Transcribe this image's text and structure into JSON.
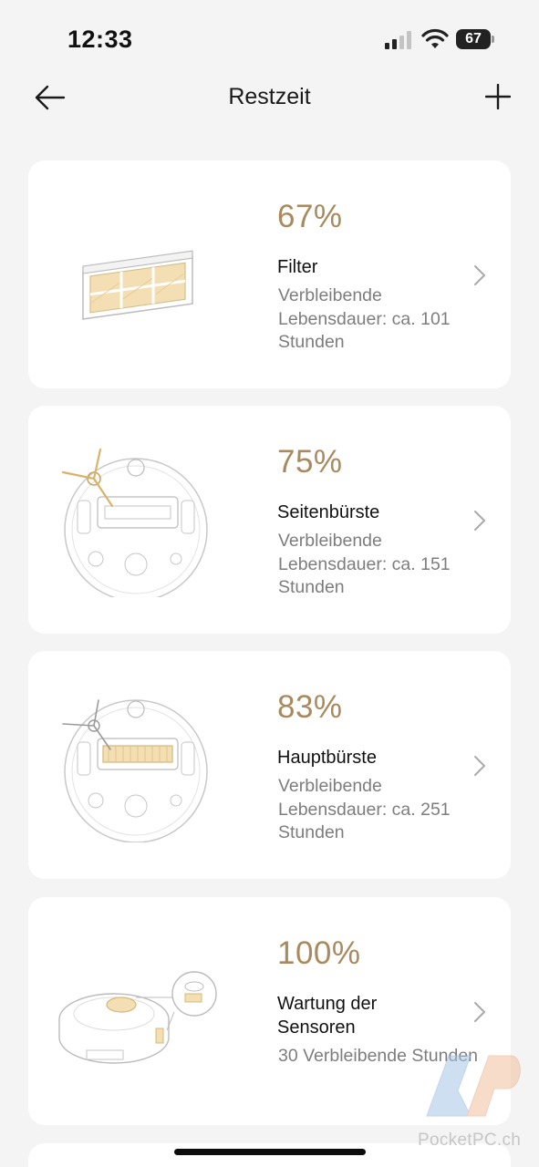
{
  "status_bar": {
    "time": "12:33",
    "battery_level": "67",
    "icons": [
      "signal-icon",
      "wifi-icon",
      "battery-icon"
    ]
  },
  "nav": {
    "title": "Restzeit",
    "back_icon": "arrow-left-icon",
    "add_icon": "plus-icon"
  },
  "accent_color": "#a88a5e",
  "items": [
    {
      "percent": "67%",
      "name": "Filter",
      "description": "Verbleibende Lebensdauer: ca. 101 Stunden",
      "image": "filter-image"
    },
    {
      "percent": "75%",
      "name": "Seitenbürste",
      "description": "Verbleibende Lebensdauer: ca. 151 Stunden",
      "image": "side-brush-image"
    },
    {
      "percent": "83%",
      "name": "Hauptbürste",
      "description": "Verbleibende Lebensdauer: ca. 251 Stunden",
      "image": "main-brush-image"
    },
    {
      "percent": "100%",
      "name": "Wartung der Sensoren",
      "description": "30 Verbleibende Stunden",
      "image": "sensor-image"
    }
  ],
  "watermark": "PocketPC.ch"
}
